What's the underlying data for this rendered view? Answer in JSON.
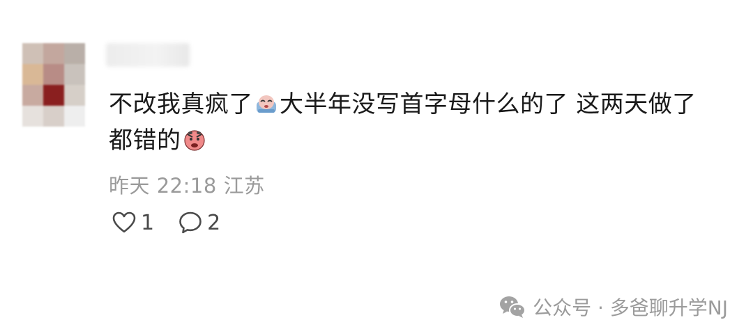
{
  "comment": {
    "avatar_colors": [
      "#cfc0b6",
      "#c3a79e",
      "#b9afa8",
      "#d9b896",
      "#b88c86",
      "#c9c2bc",
      "#c8aaa0",
      "#8a1f1f",
      "#d6cfc8",
      "#e6e1dd",
      "#d8cfc9",
      "#eeeeee"
    ],
    "text_part1": "不改我真疯了",
    "emoji1": "crying-face-emoji",
    "text_part2": "大半年没写首字母什么的了 这两天做了",
    "text_part3": "都错的",
    "emoji2": "angry-face-emoji",
    "time": "昨天 22:18",
    "location": "江苏",
    "like_count": "1",
    "reply_count": "2"
  },
  "watermark": {
    "text": "公众号 · 多爸聊升学NJ"
  },
  "colors": {
    "meta": "#9a9a9a",
    "text": "#1a1a1a",
    "icon": "#4a4a4a"
  }
}
